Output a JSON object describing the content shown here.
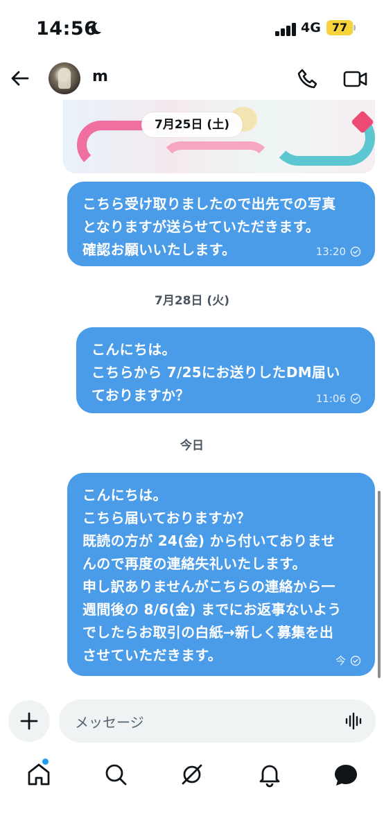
{
  "status_bar": {
    "time": "14:56",
    "network": "4G",
    "battery": "77"
  },
  "header": {
    "contact_name": "m"
  },
  "messages": [
    {
      "date_label": "7月25日 (土)",
      "text": "こちら受け取りましたので出先での写真\nとなりますが送らせていただきます。\n確認お願いいたします。",
      "time": "13:20"
    },
    {
      "date_label": "7月28日 (火)",
      "text": "こんにちは。\nこちらから 7/25にお送りしたDM届い\nておりますか？",
      "time": "11:06"
    },
    {
      "date_label": "今日",
      "text": "こんにちは。\nこちら届いておりますか？\n既読の方が 24(金) から付いておりませ\nんので再度の連絡失礼いたします。\n申し訳ありませんがこちらの連絡から一\n週間後の 8/6(金) までにお返事ないよう\nでしたらお取引の白紙→新しく募集を出\nさせていただきます。",
      "time": "今"
    }
  ],
  "composer": {
    "placeholder": "メッセージ"
  },
  "colors": {
    "bubble": "#4a9be8",
    "accent": "#1d9bf0",
    "battery": "#f6d23b"
  },
  "icons": {
    "back": "arrow-left-icon",
    "call": "phone-icon",
    "video": "video-camera-icon",
    "plus": "plus-icon",
    "voice": "waveform-icon",
    "read": "check-circle-icon",
    "nav": [
      "home-icon",
      "search-icon",
      "grok-icon",
      "bell-icon",
      "messages-icon"
    ]
  }
}
